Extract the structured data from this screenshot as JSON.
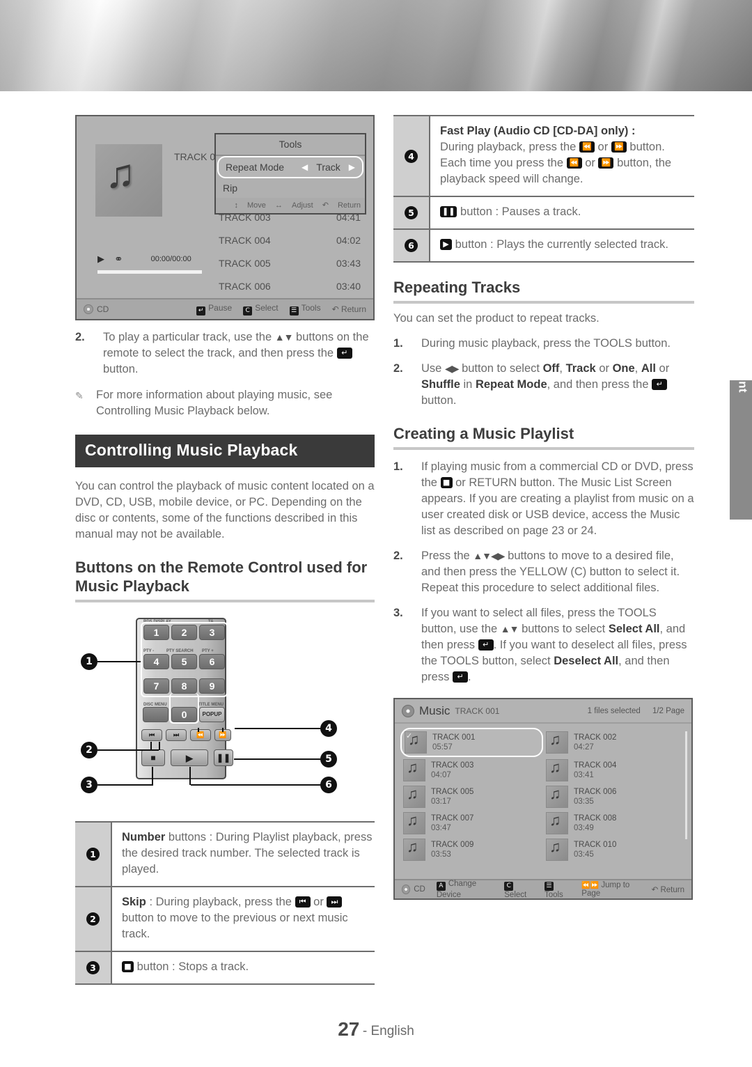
{
  "page": {
    "number": "27",
    "language": "- English",
    "side_tab": "Playing Content"
  },
  "left": {
    "tv_screenshot": {
      "track_label": "TRACK 001",
      "time": "00:00/00:00",
      "tools_popup": {
        "title": "Tools",
        "row_label": "Repeat Mode",
        "row_value": "Track",
        "row2_label": "Rip",
        "footer": {
          "move": "Move",
          "adjust": "Adjust",
          "return": "Return"
        }
      },
      "tracks": [
        {
          "name": "TRACK 003",
          "time": "04:41"
        },
        {
          "name": "TRACK 004",
          "time": "04:02"
        },
        {
          "name": "TRACK 005",
          "time": "03:43"
        },
        {
          "name": "TRACK 006",
          "time": "03:40"
        }
      ],
      "bottom_bar": {
        "source": "CD",
        "pause": "Pause",
        "select": "Select",
        "tools": "Tools",
        "return": "Return"
      }
    },
    "step2_num": "2.",
    "step2_a": "To play a particular track, use the",
    "step2_b": "buttons on the remote to select the track, and then press the",
    "step2_c": "button.",
    "note": "For more information about playing music, see Controlling Music Playback below.",
    "heading_bar": "Controlling Music Playback",
    "intro": "You can control the playback of music content located on a DVD, CD, USB, mobile device, or PC. Depending on the disc or contents, some of the functions described in this manual may not be available.",
    "sub_heading": "Buttons on the Remote Control used for Music Playback",
    "remote": {
      "labels": {
        "rds": "RDS DISPLAY",
        "ta": "TA",
        "pty_minus": "PTY -",
        "pty_search": "PTY SEARCH",
        "pty_plus": "PTY +",
        "disc_menu": "DISC MENU",
        "title_menu": "TITLE MENU"
      },
      "keys": [
        "1",
        "2",
        "3",
        "4",
        "5",
        "6",
        "7",
        "8",
        "9",
        "0"
      ],
      "popup": "POPUP",
      "callouts": [
        "1",
        "2",
        "3",
        "4",
        "5",
        "6"
      ]
    },
    "table": [
      {
        "index": "1",
        "bold": "Number",
        "text": " buttons : During Playlist playback, press the desired track number. The selected track is played."
      },
      {
        "index": "2",
        "bold": "Skip",
        "text_a": " : During playback, press the",
        "text_b": "or",
        "text_c": "button to move to the previous or next music track."
      },
      {
        "index": "3",
        "text": "button : Stops a track."
      }
    ]
  },
  "right": {
    "table": [
      {
        "index": "4",
        "title": "Fast Play (Audio CD [CD-DA] only) :",
        "line1_a": "During playback, press the",
        "line1_b": "or",
        "line1_c": "button.",
        "line2_a": "Each time you press the",
        "line2_b": "or",
        "line2_c": "button, the playback speed will change."
      },
      {
        "index": "5",
        "text": "button : Pauses a track."
      },
      {
        "index": "6",
        "text": "button : Plays the currently selected track."
      }
    ],
    "repeating": {
      "heading": "Repeating Tracks",
      "intro": "You can set the product to repeat tracks.",
      "step1_num": "1.",
      "step1": "During music playback, press the TOOLS button.",
      "step2_num": "2.",
      "step2_a": "Use",
      "step2_b": "button to select",
      "step2_off": "Off",
      "step2_track": "Track",
      "step2_or1": "or",
      "step2_one": "One",
      "step2_all": "All",
      "step2_or2": "or",
      "step2_shuffle": "Shuffle",
      "step2_in": "in",
      "step2_repeat": "Repeat Mode",
      "step2_end": ", and then press the",
      "step2_button": "button."
    },
    "playlist": {
      "heading": "Creating a Music Playlist",
      "step1_num": "1.",
      "step1_a": "If playing music from a commercial CD or DVD, press the",
      "step1_b": "or RETURN button. The Music List Screen appears. If you are creating a playlist from music on a user created disk or USB device, access the Music list as described on page 23 or 24.",
      "step2_num": "2.",
      "step2_a": "Press the",
      "step2_b": "buttons to move to a desired file, and then press the YELLOW (C) button to select it. Repeat this procedure to select additional files.",
      "step3_num": "3.",
      "step3_a": "If you want to select all files, press the TOOLS button, use the",
      "step3_b": "buttons to select",
      "step3_selectall": "Select All",
      "step3_c": ", and then press",
      "step3_d": ". If you want to deselect all files, press the TOOLS button, select",
      "step3_deselect": "Deselect All",
      "step3_e": ", and then press",
      "step3_f": "."
    },
    "music_list": {
      "title": "Music",
      "current_track": "TRACK 001",
      "selected_count": "1 files selected",
      "page": "1/2 Page",
      "items": [
        {
          "name": "TRACK 001",
          "time": "05:57",
          "selected": true
        },
        {
          "name": "TRACK 002",
          "time": "04:27",
          "selected": false
        },
        {
          "name": "TRACK 003",
          "time": "04:07",
          "selected": false
        },
        {
          "name": "TRACK 004",
          "time": "03:41",
          "selected": false
        },
        {
          "name": "TRACK 005",
          "time": "03:17",
          "selected": false
        },
        {
          "name": "TRACK 006",
          "time": "03:35",
          "selected": false
        },
        {
          "name": "TRACK 007",
          "time": "03:47",
          "selected": false
        },
        {
          "name": "TRACK 008",
          "time": "03:49",
          "selected": false
        },
        {
          "name": "TRACK 009",
          "time": "03:53",
          "selected": false
        },
        {
          "name": "TRACK 010",
          "time": "03:45",
          "selected": false
        }
      ],
      "footer": {
        "source": "CD",
        "change_device": "Change Device",
        "select": "Select",
        "tools": "Tools",
        "jump": "Jump to Page",
        "return": "Return"
      }
    }
  }
}
